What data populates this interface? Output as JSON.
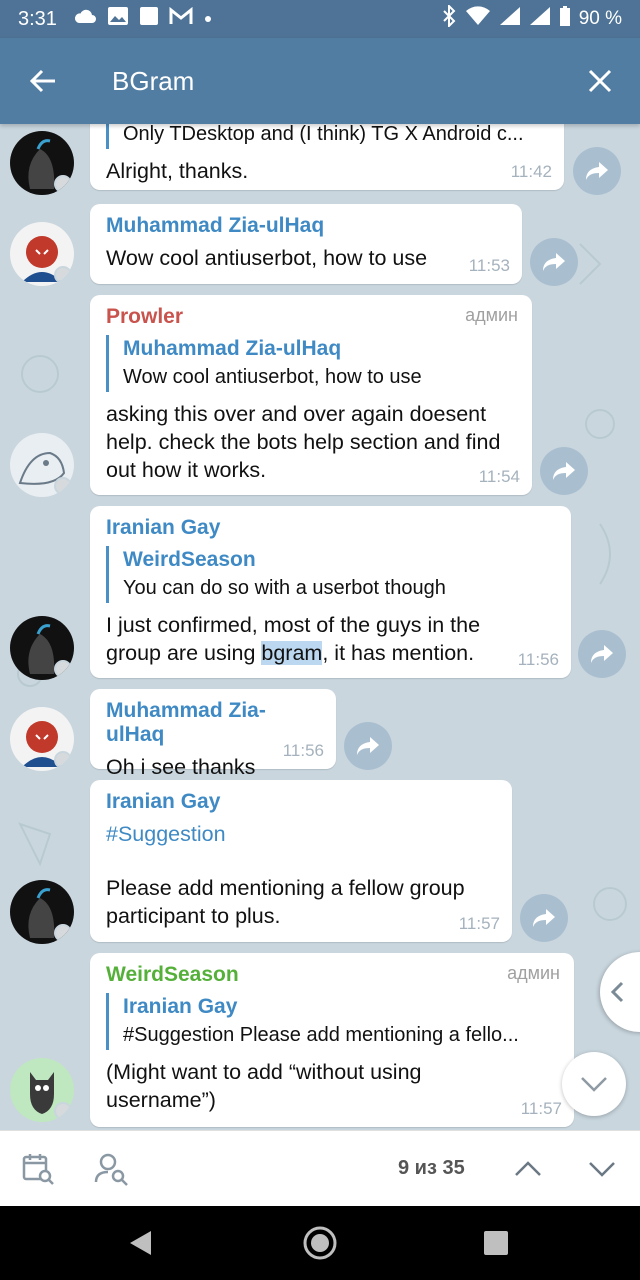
{
  "status_bar": {
    "time": "3:31",
    "battery": "90 %"
  },
  "header": {
    "title": "BGram",
    "back_icon": "arrow-left-icon",
    "close_icon": "close-icon"
  },
  "messages": [
    {
      "reply_text": "Only TDesktop and (I think) TG X Android c...",
      "text": "Alright, thanks.",
      "time": "11:42"
    },
    {
      "sender": "Muhammad Zia-ulHaq",
      "sender_color": "#3f8ac4",
      "text": "Wow cool antiuserbot, how to use",
      "time": "11:53"
    },
    {
      "sender": "Prowler",
      "sender_color": "#c9544d",
      "admin": "админ",
      "reply_name": "Muhammad Zia-ulHaq",
      "reply_text": "Wow cool antiuserbot, how to use",
      "text": "asking this over and over again doesent help. check the bots help section and find out how it works.",
      "time": "11:54"
    },
    {
      "sender": "Iranian Gay",
      "sender_color": "#3f8ac4",
      "reply_name": "WeirdSeason",
      "reply_text": "You can do so with a userbot though",
      "text_before": "I just confirmed, most of the guys in the group are using ",
      "text_highlight": "bgram",
      "text_after": ", it has mention.",
      "time": "11:56"
    },
    {
      "sender": "Muhammad Zia-ulHaq",
      "sender_color": "#3f8ac4",
      "text": "Oh i see thanks",
      "time": "11:56"
    },
    {
      "sender": "Iranian Gay",
      "sender_color": "#3f8ac4",
      "hashtag": "#Suggestion",
      "text": "Please add mentioning a fellow group participant to plus.",
      "time": "11:57"
    },
    {
      "sender": "WeirdSeason",
      "sender_color": "#55b03a",
      "admin": "админ",
      "reply_name": "Iranian Gay",
      "reply_text": "#Suggestion  Please add mentioning a fello...",
      "text": "(Might want to add “without using username”)",
      "time": "11:57"
    }
  ],
  "search_bar": {
    "counter": "9 из 35",
    "calendar_icon": "calendar-search-icon",
    "user_icon": "user-search-icon",
    "up_icon": "chevron-up-icon",
    "down_icon": "chevron-down-icon"
  },
  "colors": {
    "header": "#517da2",
    "statusbar": "#4e7396",
    "link": "#3f8ac4",
    "admin_label": "#a0a0a0"
  }
}
